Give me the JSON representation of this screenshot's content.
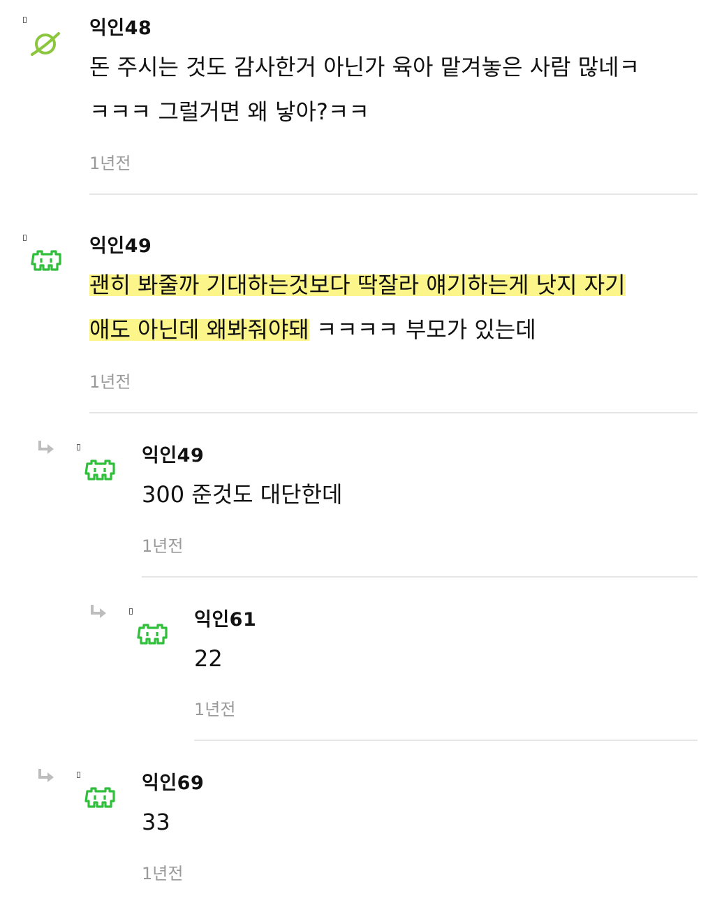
{
  "comments": [
    {
      "author": "익인48",
      "lines": [
        "돈 주시는 것도 감사한거 아닌가 육아 맡겨놓은 사람 많네ㅋ",
        "ㅋㅋㅋ 그럴거면 왜 낳아?ㅋㅋ"
      ],
      "time": "1년전",
      "avatar_icon": "planet-icon"
    },
    {
      "author": "익인49",
      "lines": [
        "괜히 봐줄까 기대하는것보다 딱잘라 얘기하는게 낫지 자기",
        "애도 아닌데 왜봐줘야돼",
        " ㅋㅋㅋㅋ 부모가 있는데"
      ],
      "time": "1년전",
      "avatar_icon": "space-invader-icon"
    },
    {
      "author": "익인49",
      "lines": [
        "300 준것도 대단한데"
      ],
      "time": "1년전",
      "avatar_icon": "space-invader-icon"
    },
    {
      "author": "익인61",
      "lines": [
        "22"
      ],
      "time": "1년전",
      "avatar_icon": "space-invader-icon"
    },
    {
      "author": "익인69",
      "lines": [
        "33"
      ],
      "time": "1년전",
      "avatar_icon": "space-invader-icon"
    }
  ],
  "colors": {
    "highlight": "#fbf58a",
    "avatar_green": "#2fbf3a",
    "planet_green": "#8cc63f",
    "time_gray": "#9a9a9a"
  }
}
